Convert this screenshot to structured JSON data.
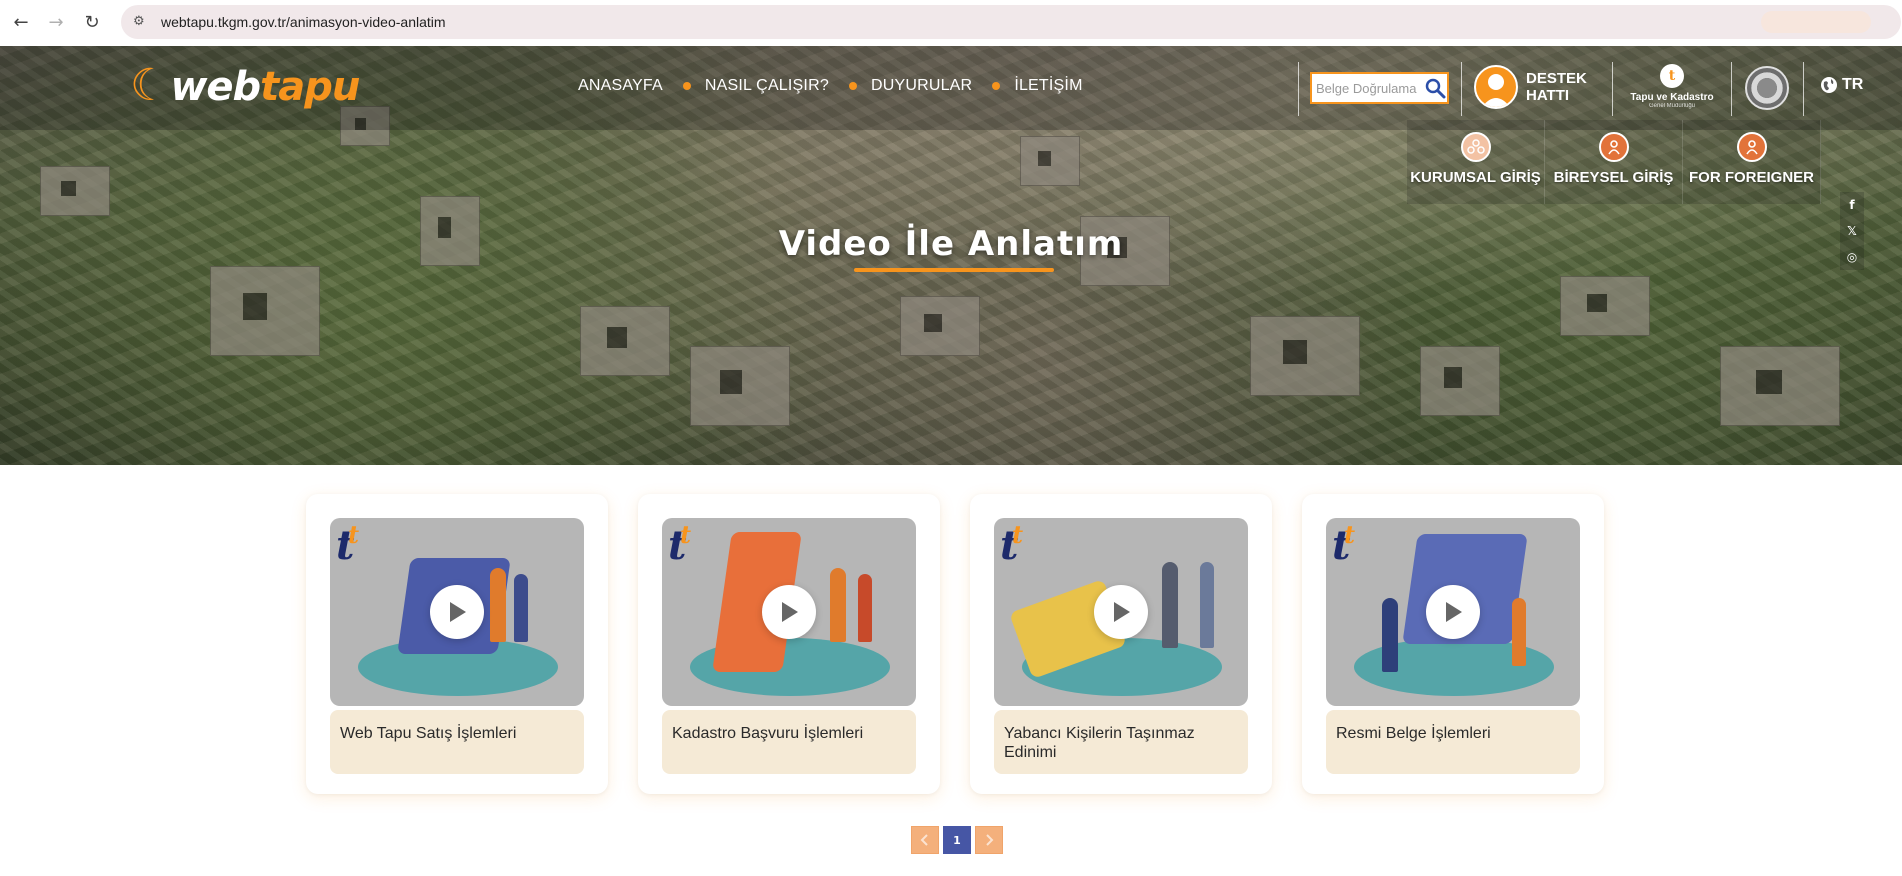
{
  "browser": {
    "back_icon": "arrow-left-icon",
    "forward_icon": "arrow-right-icon",
    "reload_icon": "reload-icon",
    "url": "webtapu.tkgm.gov.tr/animasyon-video-anlatim"
  },
  "header": {
    "logo_prefix": "web",
    "logo_accent": "tapu",
    "menu": [
      {
        "label": "ANASAYFA"
      },
      {
        "label": "NASIL ÇALIŞIR?"
      },
      {
        "label": "DUYURULAR"
      },
      {
        "label": "İLETİŞİM"
      }
    ],
    "search_placeholder": "Belge Doğrulama",
    "support_line1": "DESTEK",
    "support_line2": "HATTI",
    "institution_name": "Tapu ve Kadastro",
    "institution_sub": "Genel Müdürlüğü",
    "language": "TR"
  },
  "login": {
    "items": [
      {
        "label": "KURUMSAL GİRİŞ"
      },
      {
        "label": "BİREYSEL GİRİŞ"
      },
      {
        "label": "FOR FOREIGNER"
      }
    ]
  },
  "social": {
    "facebook": "f",
    "x": "𝕏",
    "instagram": "◎"
  },
  "hero": {
    "title": "Video İle Anlatım"
  },
  "cards": [
    {
      "title": "Web Tapu Satış İşlemleri"
    },
    {
      "title": "Kadastro Başvuru İşlemleri"
    },
    {
      "title": "Yabancı Kişilerin Taşınmaz Edinimi"
    },
    {
      "title": "Resmi Belge İşlemleri"
    }
  ],
  "pagination": {
    "current_page": "1",
    "prev_icon": "chevron-left-icon",
    "next_icon": "chevron-right-icon"
  },
  "colors": {
    "brand_orange": "#f7941d",
    "caption_bg": "#f5ead6",
    "pagination_current": "#4656a5"
  }
}
